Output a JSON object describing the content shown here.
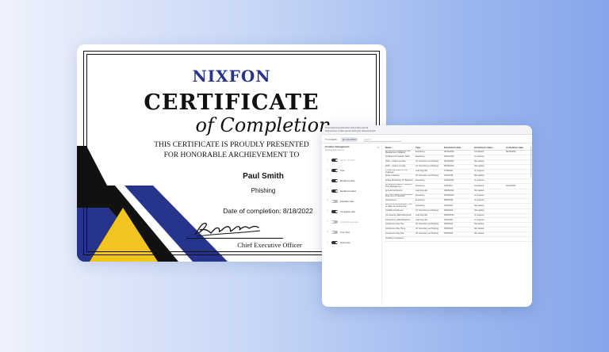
{
  "certificate": {
    "brand": "NIXFON",
    "title": "CERTIFICATE",
    "subtitle": "of Completion",
    "line1": "THIS CERTIFICATE IS PROUDLY PRESENTED",
    "line2": "FOR HONORABLE ARCHIEVEMENT TO",
    "recipient": "Paul Smith",
    "course": "Phishing",
    "completion": "Date of completion: 8/18/2022",
    "signer_role": "Chief Executive Officer",
    "colors": {
      "navy": "#27348b",
      "yellow": "#f2c41f",
      "black": "#111111"
    }
  },
  "dashboard": {
    "header_line1": "Total Continuing Education Units (CEU) earned",
    "header_line2": "Total amount of CEU earned during the selected period",
    "toolbar": {
      "filter_label": "FILTERS",
      "columns_label": "COLUMNS",
      "search_placeholder": "Search...",
      "filter_icon": "filter-icon",
      "columns_icon": "columns-icon",
      "search_icon": "search-icon"
    },
    "column_panel": {
      "title": "Column management",
      "subtitle": "Showing 8/11 columns",
      "items": [
        {
          "label": "Name - Number",
          "on": true,
          "disabled": true
        },
        {
          "label": "Type",
          "on": true,
          "disabled": false
        },
        {
          "label": "Enrollment date",
          "on": true,
          "disabled": false
        },
        {
          "label": "Enrollment status",
          "on": true,
          "disabled": false
        },
        {
          "label": "Expiration date",
          "on": false,
          "disabled": false
        },
        {
          "label": "Completion date",
          "on": true,
          "disabled": false
        },
        {
          "label": "Certificate awarded",
          "on": false,
          "disabled": true
        },
        {
          "label": "Time Time",
          "on": false,
          "disabled": false
        },
        {
          "label": "Final score",
          "on": true,
          "disabled": false
        }
      ]
    },
    "table": {
      "headers": [
        "Name ↑",
        "Type",
        "Enrollment date",
        "Enrollment status",
        "Completion date"
      ],
      "rows": [
        [
          "10 Common Leadership and Management mistakes",
          "E-learning",
          "09/14/2024",
          "Completed",
          "09/15/2024"
        ],
        [
          "10 Minute Persuasion Skills",
          "E-learning",
          "09/01/2023",
          "In progress",
          ""
        ],
        [
          "2023 - modern security",
          "ILT Instructor Led Training",
          "08/16/2023",
          "Not started",
          ""
        ],
        [
          "2023 - modern security",
          "ILT Instructor Led Training",
          "08/15/2023",
          "Not started",
          ""
        ],
        [
          "A Learning Guide for any challenge",
          "Learning plan",
          "07/6/2021",
          "In progress",
          ""
        ],
        [
          "Active Listening",
          "ILT Instructor Led Training",
          "10/4/2016",
          "Not started",
          ""
        ],
        [
          "Adobe Photoshop CC Beginner",
          "E-learning",
          "11/04/2024",
          "In progress",
          ""
        ],
        [
          "An Effective Leader's Guide to Time Management",
          "E-learning",
          "11/5/2021",
          "Completed",
          "11/14/2021"
        ],
        [
          "Annual Conference",
          "Learning plan",
          "09/05/2024",
          "Not started",
          ""
        ],
        [
          "Are You Creative at Workplace? Find out in 5 seconds!",
          "E-learning",
          "05/20/2020",
          "In progress",
          ""
        ],
        [
          "Assessment",
          "E-learning",
          "08/5/2023",
          "In progress",
          ""
        ],
        [
          "Become a Coffee Expert: How to Make the Perfect Cup",
          "E-learning",
          "09/3/2021",
          "Not started",
          ""
        ],
        [
          "Certified Conference",
          "ILT Instructor Led Training",
          "09/6/2024",
          "Not started",
          ""
        ],
        [
          "Competency Skills Advanced",
          "Learning plan",
          "09/06/2024",
          "In progress",
          ""
        ],
        [
          "Competency Skills Beginner",
          "Learning plan",
          "09/6/2024",
          "In progress",
          ""
        ],
        [
          "Conference Day One",
          "ILT Instructor Led Training",
          "09/5/2023",
          "Not started",
          ""
        ],
        [
          "Conference Day Three",
          "ILT Instructor Led Training",
          "09/5/2023",
          "Not started",
          ""
        ],
        [
          "Conference Day Two",
          "ILT Instructor Led Training",
          "09/5/2023",
          "Not started",
          ""
        ],
        [
          "Creating a Gorgeous",
          "",
          "",
          "",
          ""
        ]
      ]
    }
  }
}
